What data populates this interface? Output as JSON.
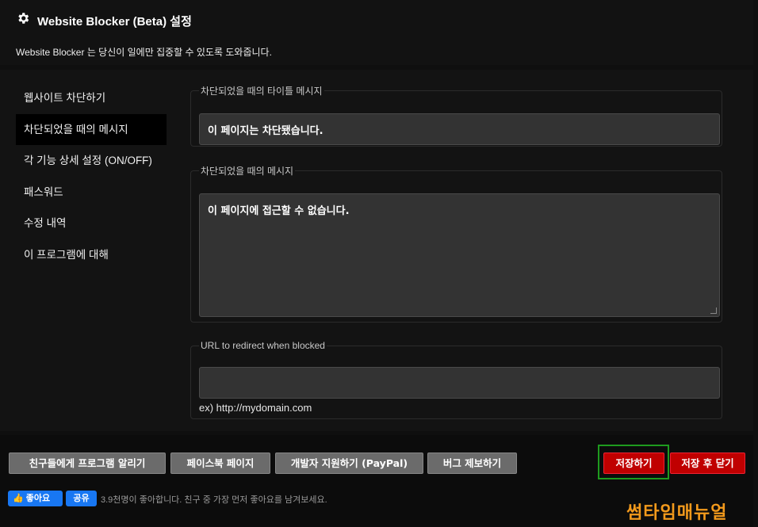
{
  "header": {
    "title": "Website Blocker (Beta) 설정",
    "subtitle": "Website Blocker 는 당신이 일에만 집중할 수 있도록 도와줍니다.",
    "icon": "gear-icon"
  },
  "sidebar": {
    "items": [
      {
        "label": "웹사이트 차단하기"
      },
      {
        "label": "차단되었을 때의 메시지"
      },
      {
        "label": "각 기능 상세 설정 (ON/OFF)"
      },
      {
        "label": "패스워드"
      },
      {
        "label": "수정 내역"
      },
      {
        "label": "이 프로그램에 대해"
      }
    ],
    "active_index": 1
  },
  "main": {
    "title_section": {
      "legend": "차단되었을 때의 타이틀 메시지",
      "value": "이 페이지는 차단됐습니다."
    },
    "message_section": {
      "legend": "차단되었을 때의 메시지",
      "value": "이 페이지에 접근할 수 없습니다."
    },
    "redirect_section": {
      "legend": "URL to redirect when blocked",
      "value": "",
      "hint": "ex) http://mydomain.com"
    }
  },
  "footer": {
    "buttons": {
      "tell_friends": "친구들에게 프로그램 알리기",
      "facebook_page": "페이스북 페이지",
      "support_dev": "개발자 지원하기 (PayPal)",
      "report_bug": "버그 제보하기",
      "save": "저장하기",
      "save_close": "저장 후 닫기"
    },
    "facebook": {
      "like_label": "좋아요",
      "share_label": "공유",
      "like_text": "3.9천명이 좋아합니다. 친구 중 가장 먼저 좋아요를 남겨보세요."
    },
    "watermark": "썸타임매뉴얼"
  },
  "colors": {
    "accent_red": "#c00000",
    "highlight_green": "#1e9b1e",
    "facebook_blue": "#1877f2",
    "watermark_orange": "#f39a1c"
  }
}
